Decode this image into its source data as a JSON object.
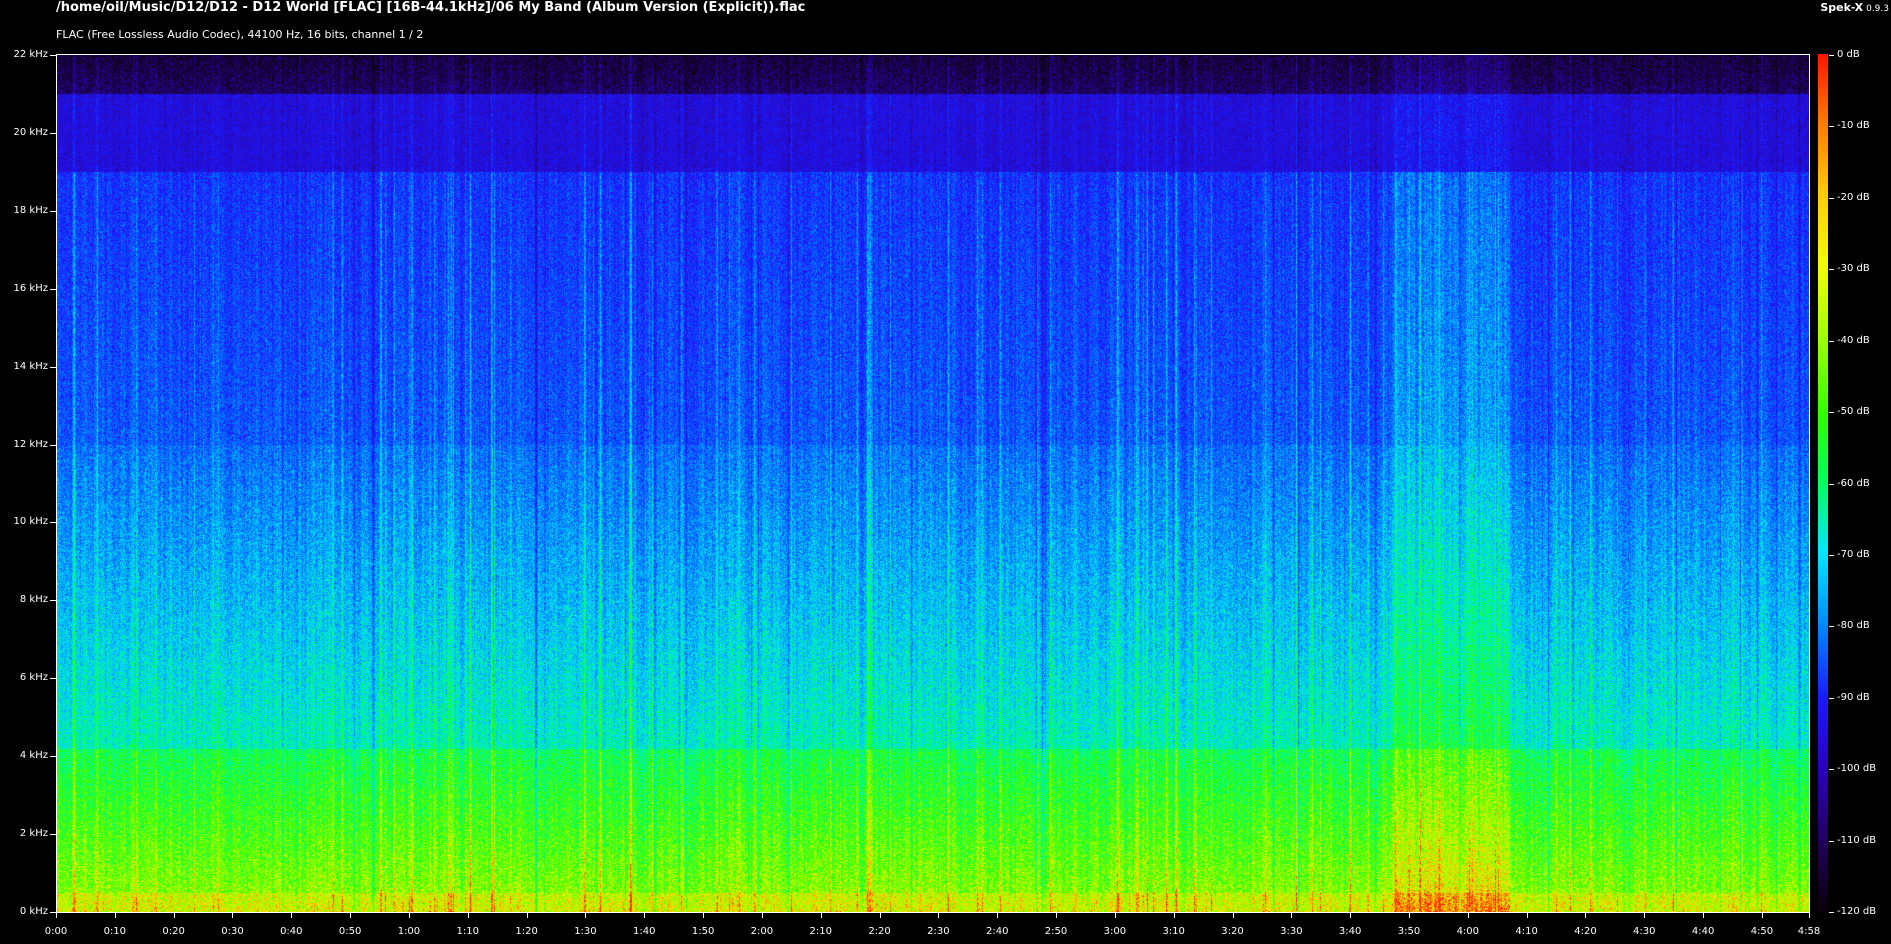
{
  "header": {
    "file_title": "/home/oil/Music/D12/D12 - D12 World [FLAC] [16B-44.1kHz]/06 My Band (Album Version (Explicit)).flac",
    "file_info": "FLAC (Free Lossless Audio Codec), 44100 Hz, 16 bits, channel 1 / 2",
    "app_name": "Spek-X",
    "app_version": "0.9.3"
  },
  "frequency_axis": {
    "labels": [
      "0 kHz",
      "2 kHz",
      "4 kHz",
      "6 kHz",
      "8 kHz",
      "10 kHz",
      "12 kHz",
      "14 kHz",
      "16 kHz",
      "18 kHz",
      "20 kHz",
      "22 kHz"
    ],
    "max_khz": 22
  },
  "time_axis": {
    "labels": [
      "0:00",
      "0:10",
      "0:20",
      "0:30",
      "0:40",
      "0:50",
      "1:00",
      "1:10",
      "1:20",
      "1:30",
      "1:40",
      "1:50",
      "2:00",
      "2:10",
      "2:20",
      "2:30",
      "2:40",
      "2:50",
      "3:00",
      "3:10",
      "3:20",
      "3:30",
      "3:40",
      "3:50",
      "4:00",
      "4:10",
      "4:20",
      "4:30",
      "4:40",
      "4:50",
      "4:58"
    ],
    "duration_seconds": 298
  },
  "colorbar": {
    "labels": [
      "0 dB",
      "-10 dB",
      "-20 dB",
      "-30 dB",
      "-40 dB",
      "-50 dB",
      "-60 dB",
      "-70 dB",
      "-80 dB",
      "-90 dB",
      "-100 dB",
      "-110 dB",
      "-120 dB"
    ],
    "min_db": -120,
    "max_db": 0
  },
  "colors": {
    "background": "#000000",
    "spectrum_high": "#ff1500",
    "spectrum_mid": "#30ff00",
    "spectrum_low": "#1a1aff"
  }
}
